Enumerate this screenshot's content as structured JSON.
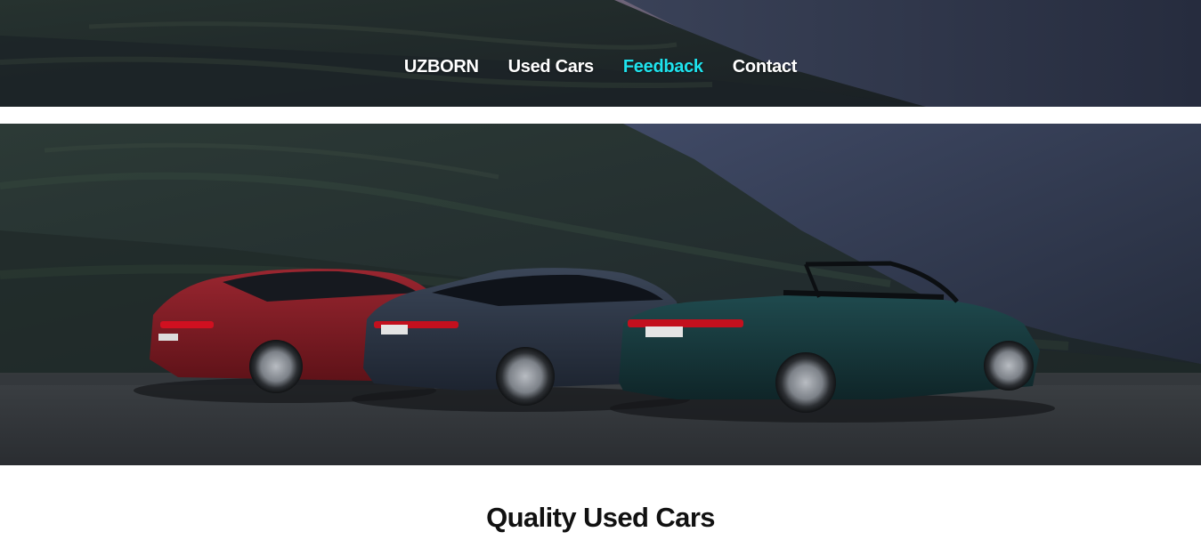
{
  "nav": {
    "items": [
      {
        "label": "UZBORN",
        "active": false
      },
      {
        "label": "Used Cars",
        "active": false
      },
      {
        "label": "Feedback",
        "active": true
      },
      {
        "label": "Contact",
        "active": false
      }
    ],
    "active_color": "#1ee3ee",
    "text_color": "#ffffff"
  },
  "hero": {
    "image": "three cars parked on gravel in front of mountains",
    "cars": [
      {
        "color": "#7a1a22",
        "plate": ""
      },
      {
        "color": "#2b3545",
        "plate": "IN:A 5000"
      },
      {
        "color": "#17343a",
        "plate": "IN:A 5050"
      }
    ]
  },
  "main": {
    "title": "Quality Used Cars"
  }
}
